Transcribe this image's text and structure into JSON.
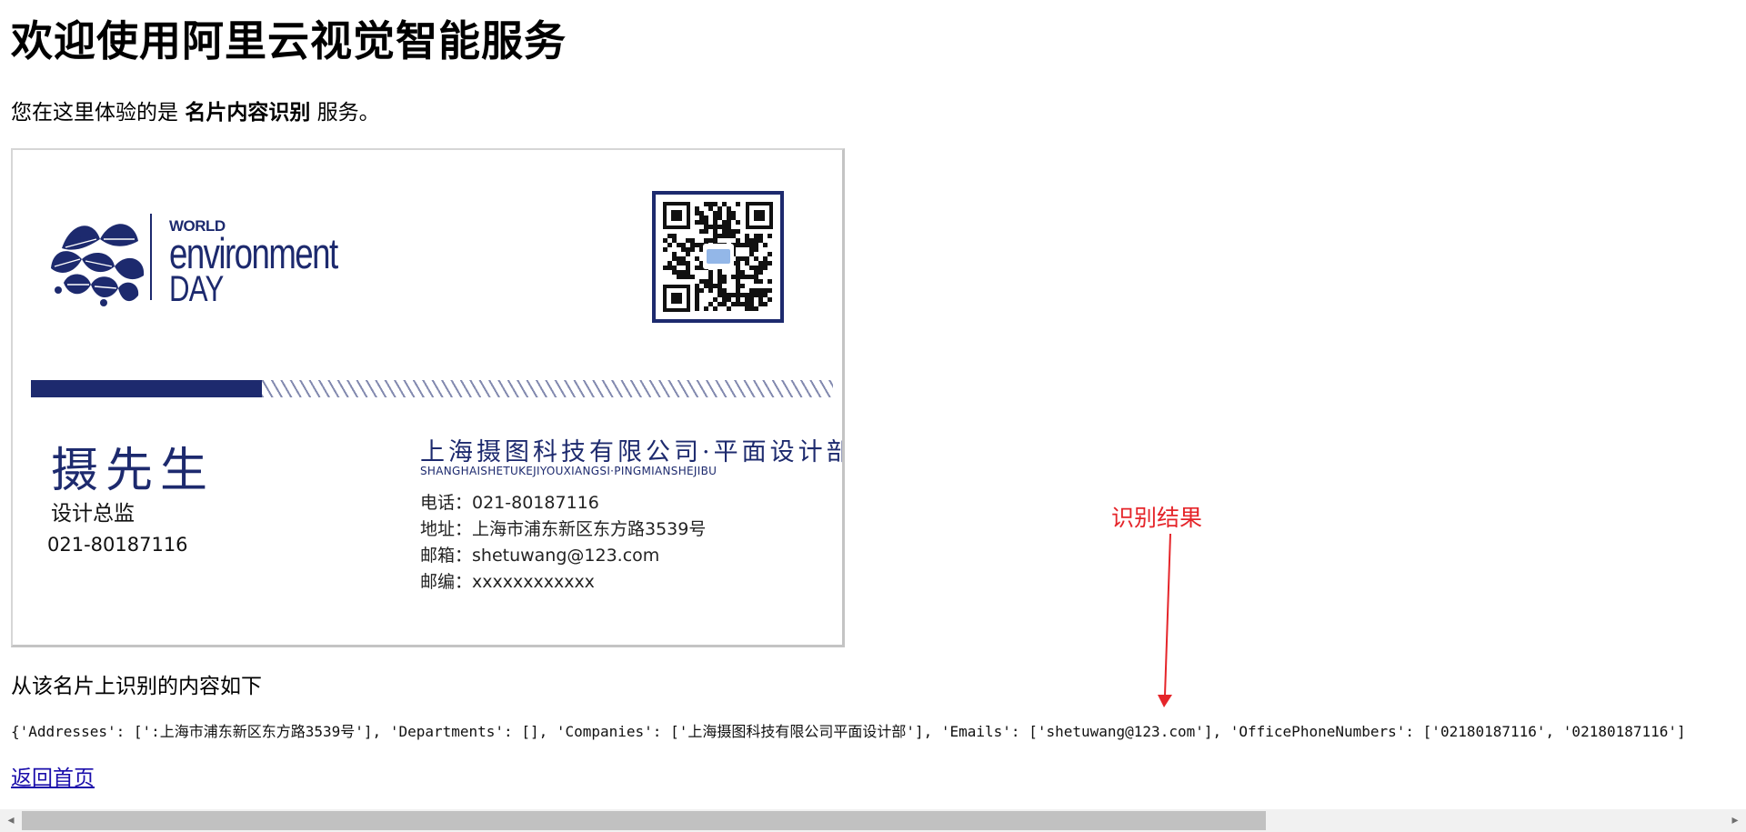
{
  "page": {
    "heading": "欢迎使用阿里云视觉智能服务",
    "intro_prefix": "您在这里体验的是 ",
    "intro_service": "名片内容识别",
    "intro_suffix": " 服务。",
    "result_caption": "从该名片上识别的内容如下",
    "result_text": "{'Addresses': [':上海市浦东新区东方路3539号'], 'Departments': [], 'Companies': ['上海摄图科技有限公司平面设计部'], 'Emails': ['shetuwang@123.com'], 'OfficePhoneNumbers': ['02180187116', '02180187116']",
    "home_link": "返回首页"
  },
  "card": {
    "logo_world": "WORLD",
    "logo_environment": "environment",
    "logo_day": "DAY",
    "person_name": "摄先生",
    "person_title": "设计总监",
    "person_phone": "021-80187116",
    "company_name": "上海摄图科技有限公司·平面设计部",
    "company_pinyin": "SHANGHAISHETUKEJIYOUXIANGSI·PINGMIANSHEJIBU",
    "phone_line": "电话：021-80187116",
    "address_line": "地址：上海市浦东新区东方路3539号",
    "email_line": "邮箱：shetuwang@123.com",
    "postcode_line": "邮编：xxxxxxxxxxxx",
    "brand_color": "#1d2a6e"
  },
  "annotation": {
    "label": "识别结果",
    "color": "#e5252a"
  },
  "scrollbar": {
    "left_arrow": "◂",
    "right_arrow": "▸"
  }
}
